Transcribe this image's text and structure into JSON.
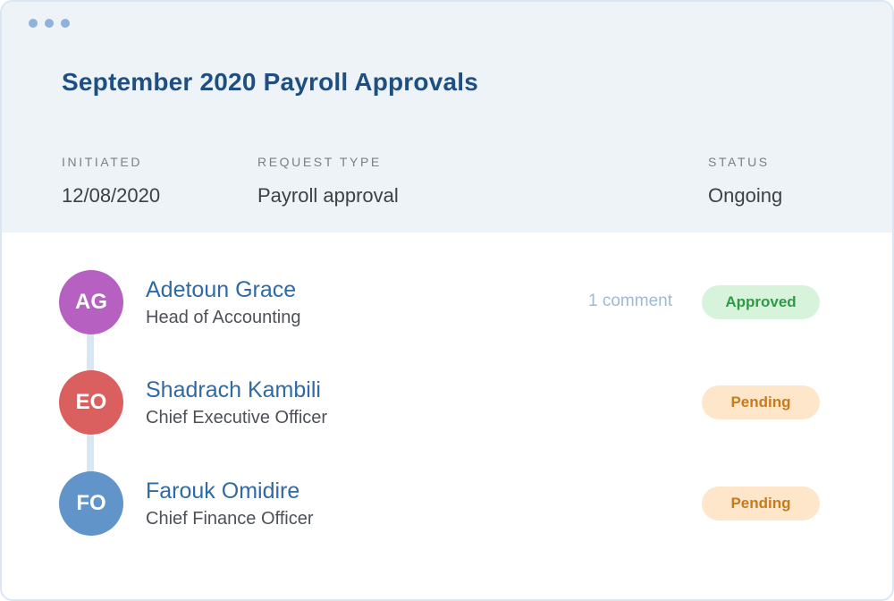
{
  "window": {
    "title": "September 2020 Payroll Approvals"
  },
  "meta": {
    "initiated_label": "INITIATED",
    "initiated_value": "12/08/2020",
    "request_type_label": "REQUEST TYPE",
    "request_type_value": "Payroll approval",
    "status_label": "STATUS",
    "status_value": "Ongoing"
  },
  "approvers": [
    {
      "initials": "AG",
      "name": "Adetoun Grace",
      "role": "Head of Accounting",
      "comment": "1 comment",
      "status": "Approved",
      "avatar_color": "#b660c1"
    },
    {
      "initials": "EO",
      "name": "Shadrach Kambili",
      "role": "Chief Executive Officer",
      "status": "Pending",
      "avatar_color": "#d9605e"
    },
    {
      "initials": "FO",
      "name": "Farouk Omidire",
      "role": "Chief Finance Officer",
      "status": "Pending",
      "avatar_color": "#6194c9"
    }
  ],
  "colors": {
    "title": "#1f4f80",
    "name": "#2f6aa5",
    "approved_bg": "#d8f3dc",
    "approved_text": "#2e9a45",
    "pending_bg": "#fde6c9",
    "pending_text": "#c97a1a"
  }
}
